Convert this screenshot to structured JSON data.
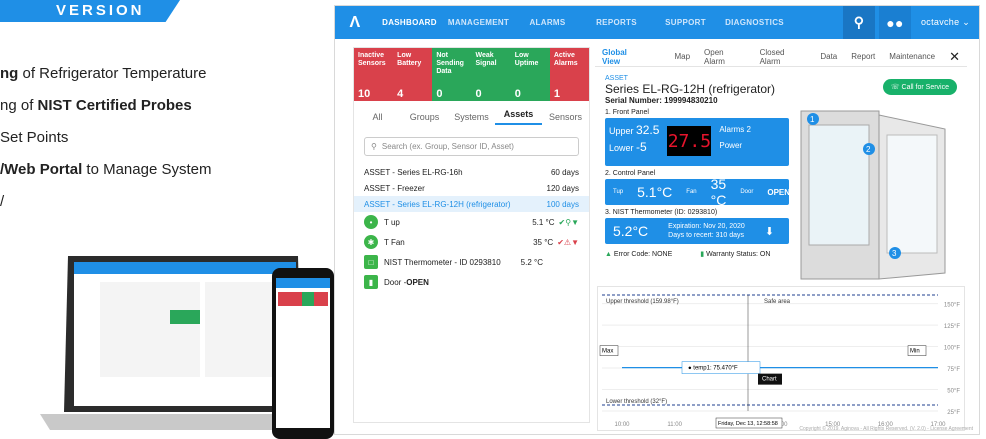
{
  "banner": "VERSION",
  "bullets": [
    {
      "pre": "",
      "bold": "ng",
      "post": " of Refrigerator Temperature"
    },
    {
      "pre": "ng of ",
      "bold": "NIST Certified Probes",
      "post": ""
    },
    {
      "pre": " Set Points",
      "bold": "",
      "post": ""
    },
    {
      "pre": "",
      "bold": "/Web Portal",
      "post": " to Manage System"
    },
    {
      "pre": "",
      "bold": "",
      "post": "/"
    }
  ],
  "nav": {
    "items": [
      "DASHBOARD",
      "MANAGEMENT",
      "ALARMS",
      "REPORTS",
      "SUPPORT",
      "DIAGNOSTICS"
    ],
    "user": "octavche"
  },
  "tiles": [
    {
      "label": "Inactive Sensors",
      "num": "10",
      "color": "#d9414b"
    },
    {
      "label": "Low Battery",
      "num": "4",
      "color": "#d9414b"
    },
    {
      "label": "Not Sending Data",
      "num": "0",
      "color": "#2aa75a"
    },
    {
      "label": "Weak Signal",
      "num": "0",
      "color": "#2aa75a"
    },
    {
      "label": "Low Uptime",
      "num": "0",
      "color": "#2aa75a"
    },
    {
      "label": "Active Alarms",
      "num": "1",
      "color": "#d9414b"
    }
  ],
  "left_tabs": [
    "All",
    "Groups",
    "Systems",
    "Assets",
    "Sensors"
  ],
  "search_placeholder": "Search (ex. Group, Sensor ID, Asset)",
  "assets": [
    {
      "name": "ASSET - Series EL-RG-16h",
      "days": "60 days"
    },
    {
      "name": "ASSET - Freezer",
      "days": "120 days"
    },
    {
      "name": "ASSET - Series EL-RG-12H (refrigerator)",
      "days": "100 days"
    }
  ],
  "sensors": [
    {
      "name": "T up",
      "value": "5.1 °C"
    },
    {
      "name": "T Fan",
      "value": "35 °C"
    },
    {
      "name": "NIST Thermometer - ID 0293810",
      "value": "5.2 °C"
    }
  ],
  "door": {
    "label": "Door - ",
    "state": "OPEN"
  },
  "right_tabs": [
    "Global View",
    "Map",
    "Open Alarm",
    "Closed Alarm",
    "Data",
    "Report",
    "Maintenance"
  ],
  "asset_label": "ASSET",
  "asset_title": "Series EL-RG-12H (refrigerator)",
  "serial": "Serial Number: 199994830210",
  "call_btn": "Call for Service",
  "front_panel": {
    "title": "1. Front Panel",
    "upper_label": "Upper",
    "upper": "32.5",
    "lower_label": "Lower",
    "lower": "-5",
    "display": "27.5",
    "alarms": "Alarms 2",
    "power": "Power"
  },
  "control_panel": {
    "title": "2. Control Panel",
    "tup_label": "Tup",
    "tup": "5.1°C",
    "fan_label": "Fan",
    "fan": "35 °C",
    "door_label": "Door",
    "door": "OPEN"
  },
  "nist": {
    "title": "3. NIST Thermometer (ID: 0293810)",
    "value": "5.2°C",
    "expiration": "Expiration: Nov 20, 2020",
    "recert": "Days to recert: 310 days"
  },
  "status": {
    "error": "Error Code: NONE",
    "warranty": "Warranty Status: ON"
  },
  "chart_data": {
    "type": "line",
    "title": "",
    "upper_threshold_label": "Upper threshold (159.98°F)",
    "lower_threshold_label": "Lower threshold (32°F)",
    "safe_area_label": "Safe area",
    "max_label": "Max",
    "min_label": "Min",
    "chart_btn": "Chart",
    "tooltip": "temp1: 75.470°F",
    "cursor_label": "Friday, Dec 13, 12:58:58",
    "x_ticks": [
      "10:00",
      "11:00",
      "12:00",
      "14:00",
      "15:00",
      "16:00",
      "17:00"
    ],
    "y_ticks": [
      "150°F",
      "125°F",
      "100°F",
      "75°F",
      "50°F",
      "25°F"
    ],
    "ylim": [
      25,
      160
    ],
    "series": [
      {
        "values": [
          75.47,
          75.47,
          75.47,
          75.47,
          75.47,
          75.47,
          75.47
        ]
      }
    ],
    "line_color": "#1f8fe6"
  },
  "copyright": "Copyright © 2019. Aginova - All Rights Reserved. (V. 2.0) - License Agreement"
}
